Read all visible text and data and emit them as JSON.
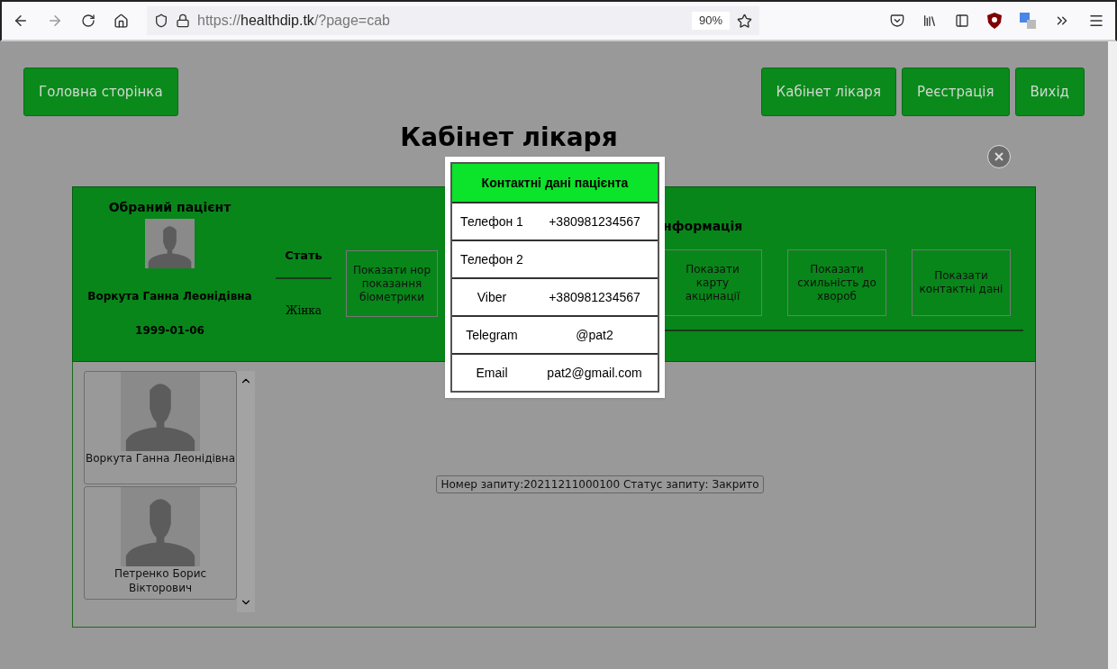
{
  "browser": {
    "url_prefix": "https://",
    "url_host": "healthdip.tk",
    "url_path": "/?page=cab",
    "zoom": "90%"
  },
  "nav": {
    "left": [
      "Головна сторінка"
    ],
    "right": [
      "Кабінет лікаря",
      "Реєстрація",
      "Вихід"
    ]
  },
  "page_title": "Кабінет лікаря",
  "patient": {
    "heading": "Обраний пацієнт",
    "name": "Воркута Ганна Леонідівна",
    "birth_date": "1999-01-06"
  },
  "gender": {
    "label": "Стать",
    "value": "Жінка"
  },
  "info_heading": "нформація",
  "actions": [
    {
      "lines": [
        "Показати нор",
        "показання",
        "біометрики"
      ]
    },
    {
      "lines": [
        "Показати",
        "карту",
        "акцинації"
      ]
    },
    {
      "lines": [
        "Показати",
        "схильність до",
        "хвороб"
      ]
    },
    {
      "lines": [
        "Показати",
        "контактні дані"
      ]
    }
  ],
  "patients": [
    {
      "name": "Воркута Ганна Леонідівна"
    },
    {
      "name": "Петренко Борис Вікторович"
    }
  ],
  "request": "Номер запиту:20211211000100 Статус запиту: Закрито",
  "modal": {
    "title": "Контактні дані пацієнта",
    "rows": [
      {
        "label": "Телефон 1",
        "value": "+380981234567"
      },
      {
        "label": "Телефон 2"
      },
      {
        "label": "Viber",
        "value": "+380981234567"
      },
      {
        "label": "Telegram",
        "value": "@pat2"
      },
      {
        "label": "Email",
        "value": "pat2@gmail.com"
      }
    ]
  }
}
